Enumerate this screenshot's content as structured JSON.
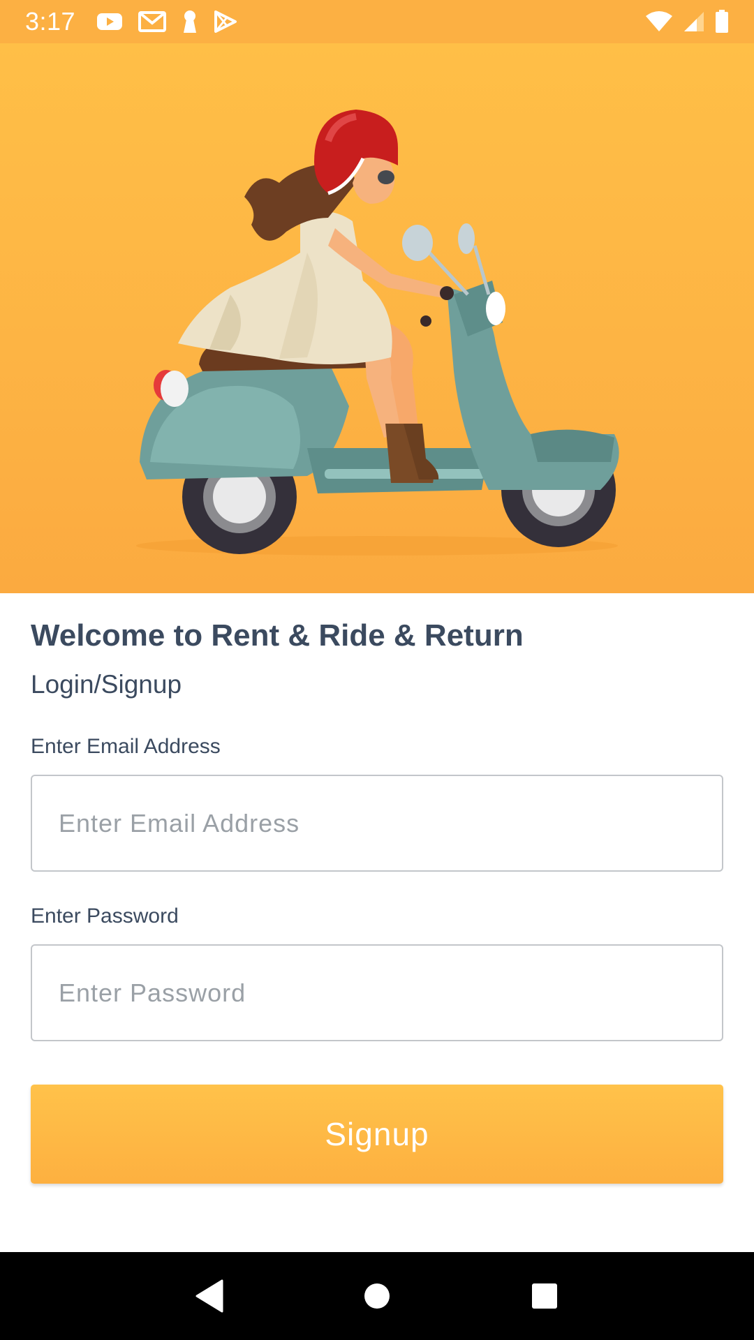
{
  "status_bar": {
    "time": "3:17",
    "left_icons": [
      "youtube-icon",
      "gmail-icon",
      "keyhole-icon",
      "play-store-icon"
    ],
    "right_icons": [
      "wifi-icon",
      "signal-icon",
      "battery-icon"
    ]
  },
  "hero": {
    "illustration": "woman-riding-scooter"
  },
  "login": {
    "title": "Welcome to Rent & Ride & Return",
    "subtitle": "Login/Signup",
    "email_label": "Enter Email Address",
    "email_placeholder": "Enter Email Address",
    "email_value": "",
    "password_label": "Enter Password",
    "password_placeholder": "Enter Password",
    "password_value": "",
    "signup_label": "Signup"
  },
  "nav_bar": {
    "buttons": [
      "back-icon",
      "home-icon",
      "recents-icon"
    ]
  },
  "colors": {
    "accent": "#fdb444",
    "text": "#3b4a5f",
    "placeholder": "#9aa0a6"
  }
}
